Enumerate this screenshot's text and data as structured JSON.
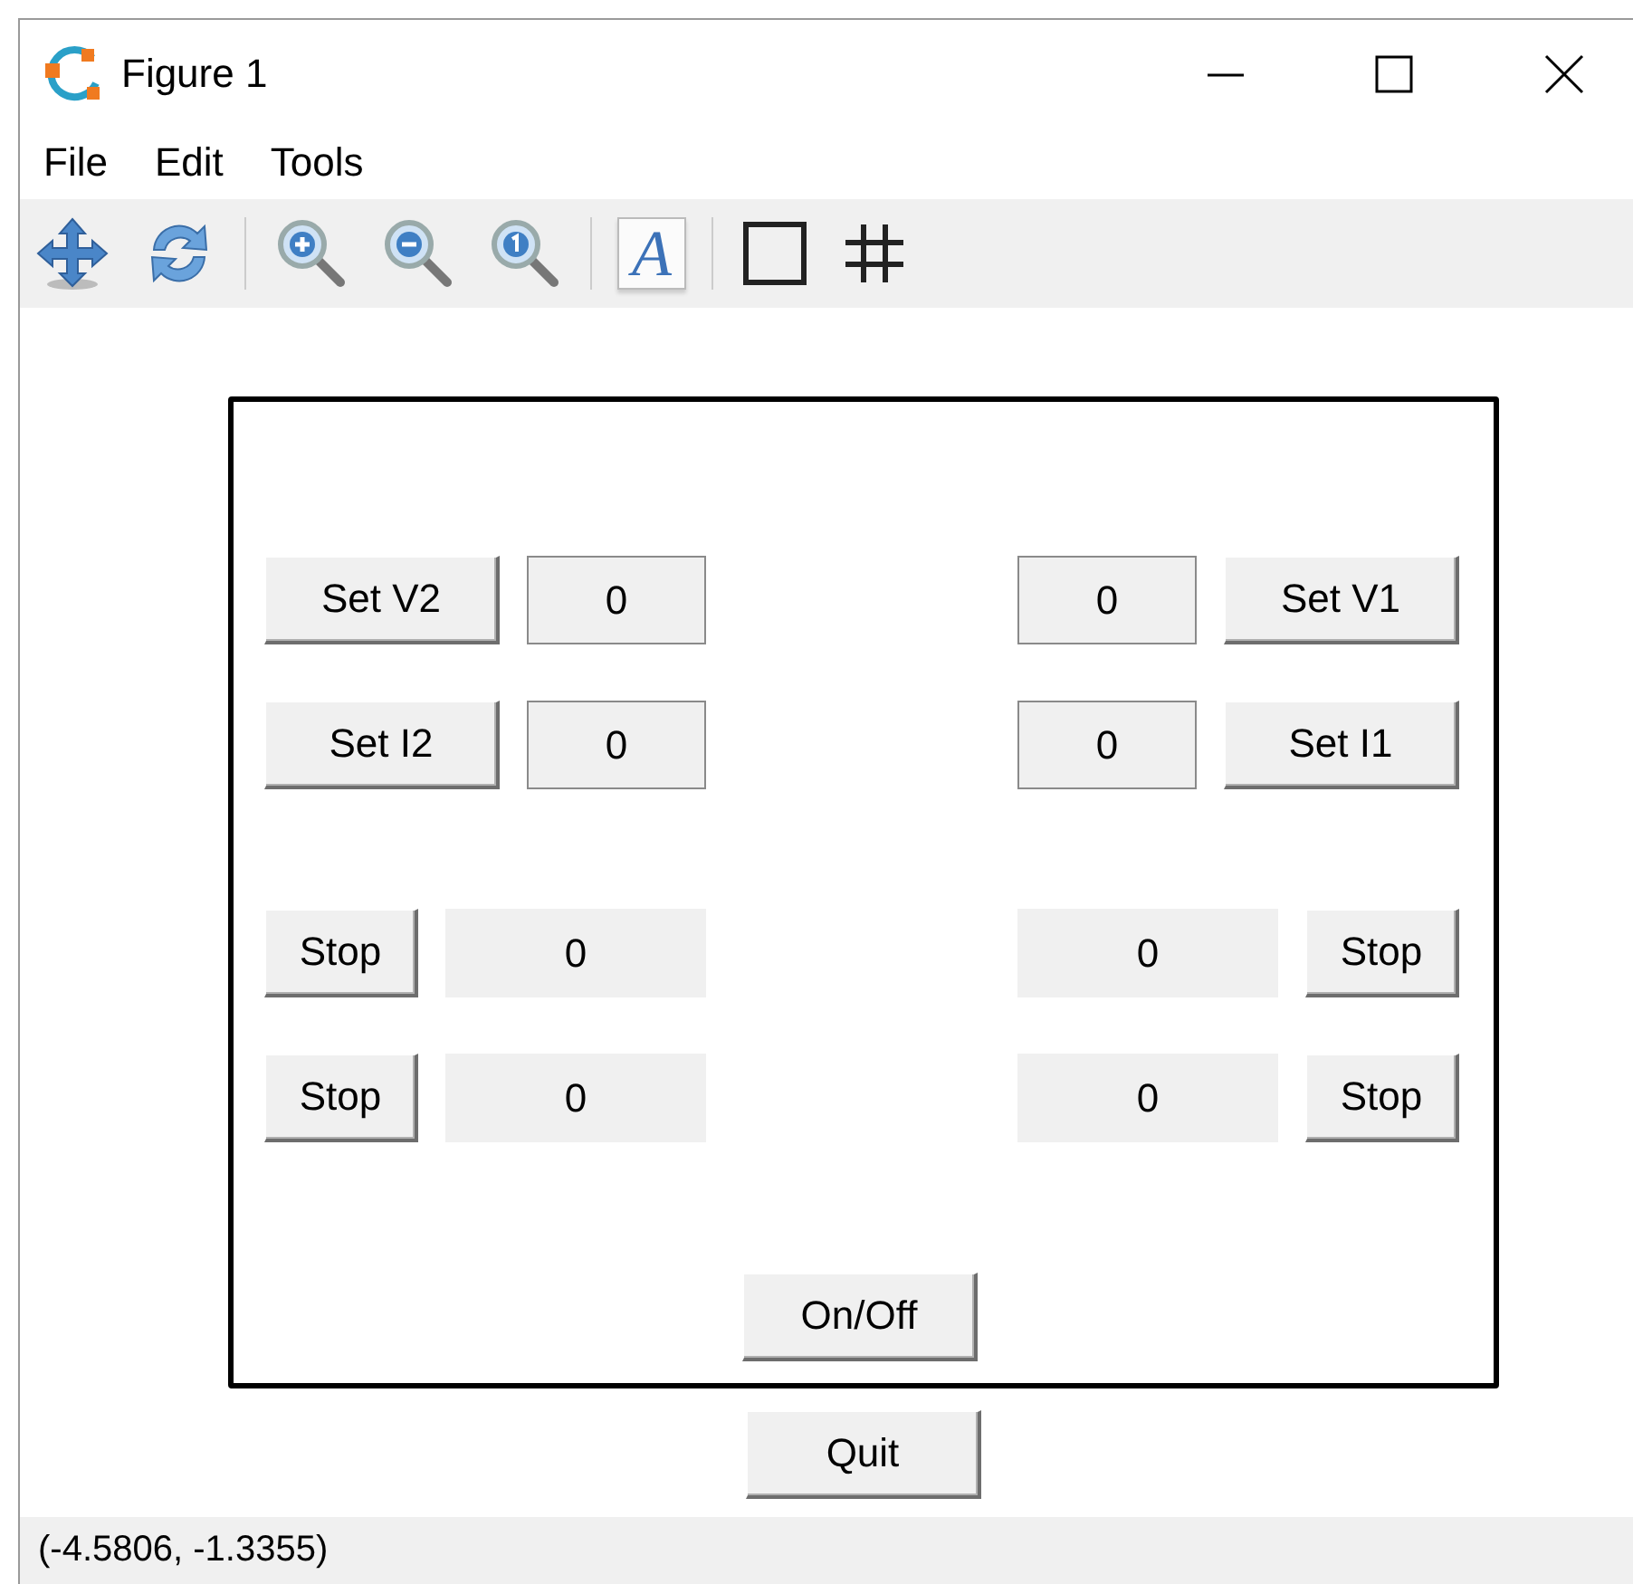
{
  "window": {
    "title": "Figure 1"
  },
  "menu": [
    "File",
    "Edit",
    "Tools"
  ],
  "toolbar": [
    {
      "kind": "move"
    },
    {
      "kind": "refresh"
    },
    {
      "kind": "separator"
    },
    {
      "kind": "zoom_in"
    },
    {
      "kind": "zoom_out"
    },
    {
      "kind": "zoom_reset"
    },
    {
      "kind": "separator"
    },
    {
      "kind": "text",
      "label": "A"
    },
    {
      "kind": "separator"
    },
    {
      "kind": "frame"
    },
    {
      "kind": "grid"
    }
  ],
  "panel": {
    "rows": [
      {
        "kind": "setpoint",
        "left": {
          "button": "Set V2",
          "value": "0"
        },
        "right": {
          "value": "0",
          "button": "Set V1"
        }
      },
      {
        "kind": "setpoint",
        "left": {
          "button": "Set I2",
          "value": "0"
        },
        "right": {
          "value": "0",
          "button": "Set I1"
        }
      },
      {
        "kind": "readout",
        "left": {
          "button": "Stop",
          "value": "0"
        },
        "right": {
          "value": "0",
          "button": "Stop"
        }
      },
      {
        "kind": "readout",
        "left": {
          "button": "Stop",
          "value": "0"
        },
        "right": {
          "value": "0",
          "button": "Stop"
        }
      }
    ],
    "center_button": "On/Off"
  },
  "quit_button": "Quit",
  "status_bar": "(-4.5806, -1.3355)"
}
